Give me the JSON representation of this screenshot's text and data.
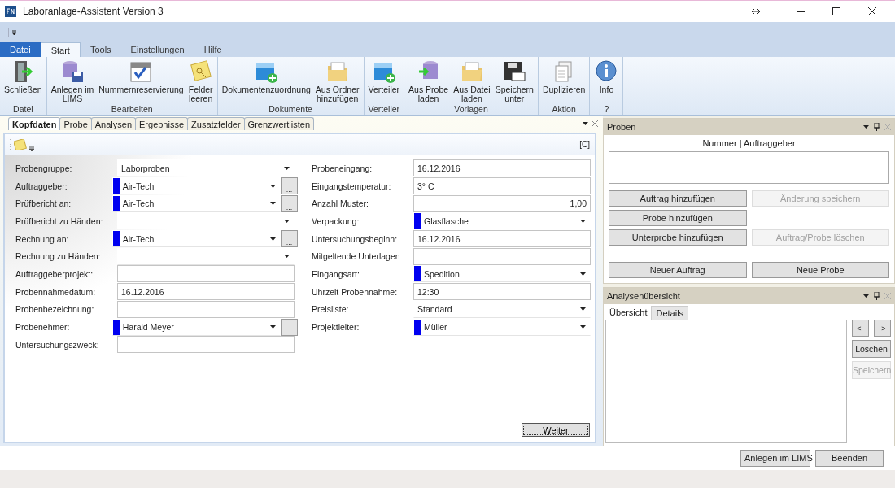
{
  "window": {
    "title": "Laboranlage-Assistent Version 3"
  },
  "ribbon_tabs": [
    {
      "label": "Datei",
      "kind": "file",
      "selected": false
    },
    {
      "label": "Start",
      "kind": "tab",
      "selected": true
    },
    {
      "label": "Tools",
      "kind": "tab",
      "selected": false
    },
    {
      "label": "Einstellungen",
      "kind": "tab",
      "selected": false
    },
    {
      "label": "Hilfe",
      "kind": "tab",
      "selected": false
    }
  ],
  "ribbon_groups": [
    {
      "label": "Datei",
      "items": [
        {
          "label": "Schließen",
          "kind": "exit"
        }
      ]
    },
    {
      "label": "Bearbeiten",
      "items": [
        {
          "label": "Anlegen im\nLIMS",
          "kind": "database-save"
        },
        {
          "label": "Nummernreservierung",
          "kind": "calendar"
        },
        {
          "label": "Felder\nleeren",
          "kind": "note"
        }
      ]
    },
    {
      "label": "Dokumente",
      "items": [
        {
          "label": "Dokumentenzuordnung",
          "kind": "box-plus"
        },
        {
          "label": "Aus Ordner\nhinzufügen",
          "kind": "folder"
        }
      ]
    },
    {
      "label": "Verteiler",
      "items": [
        {
          "label": "Verteiler",
          "kind": "box-plus"
        }
      ]
    },
    {
      "label": "Vorlagen",
      "items": [
        {
          "label": "Aus Probe\nladen",
          "kind": "database-load"
        },
        {
          "label": "Aus Datei\nladen",
          "kind": "folder"
        },
        {
          "label": "Speichern\nunter",
          "kind": "save-as"
        }
      ]
    },
    {
      "label": "Aktion",
      "items": [
        {
          "label": "Duplizieren",
          "kind": "copy"
        }
      ]
    },
    {
      "label": "?",
      "items": [
        {
          "label": "Info",
          "kind": "info"
        }
      ]
    }
  ],
  "document_tabs": [
    {
      "label": "Kopfdaten",
      "selected": true
    },
    {
      "label": "Probe",
      "selected": false
    },
    {
      "label": "Analysen",
      "selected": false
    },
    {
      "label": "Ergebnisse",
      "selected": false
    },
    {
      "label": "Zusatzfelder",
      "selected": false
    },
    {
      "label": "Grenzwertlisten",
      "selected": false
    }
  ],
  "document_toolbar": {
    "code": "[C]"
  },
  "form_left": [
    {
      "label": "Probengruppe:",
      "kind": "combo",
      "value": "Laborproben",
      "required": false
    },
    {
      "label": "Auftraggeber:",
      "kind": "combo",
      "value": "Air-Tech",
      "required": true,
      "browse_button": "..."
    },
    {
      "label": "Prüfbericht an:",
      "kind": "combo",
      "value": "Air-Tech",
      "required": true,
      "browse_button": "..."
    },
    {
      "label": "Prüfbericht zu Händen:",
      "kind": "combo",
      "required": false
    },
    {
      "label": "Rechnung an:",
      "kind": "combo",
      "value": "Air-Tech",
      "required": true,
      "browse_button": "..."
    },
    {
      "label": "Rechnung zu Händen:",
      "kind": "combo",
      "required": false
    },
    {
      "label": "Auftraggeberprojekt:",
      "kind": "text",
      "required": false
    },
    {
      "label": "Probennahmedatum:",
      "kind": "text",
      "value": "16.12.2016",
      "required": false
    },
    {
      "label": "Probenbezeichnung:",
      "kind": "text",
      "required": false
    },
    {
      "label": "Probenehmer:",
      "kind": "combo",
      "value": "Harald Meyer",
      "required": true,
      "browse_button": "..."
    },
    {
      "label": "Untersuchungszweck:",
      "kind": "text",
      "required": false
    }
  ],
  "form_right": [
    {
      "label": "Probeneingang:",
      "kind": "text",
      "value": "16.12.2016",
      "required": false
    },
    {
      "label": "Eingangstemperatur:",
      "kind": "text",
      "value": "3° C",
      "required": false
    },
    {
      "label": "Anzahl Muster:",
      "kind": "number",
      "value": "1,00",
      "required": false
    },
    {
      "label": "Verpackung:",
      "kind": "combo",
      "value": "Glasflasche",
      "required": true
    },
    {
      "label": "Untersuchungsbeginn:",
      "kind": "text",
      "value": "16.12.2016",
      "required": false
    },
    {
      "label": "Mitgeltende Unterlagen",
      "kind": "text",
      "required": false
    },
    {
      "label": "Eingangsart:",
      "kind": "combo",
      "value": "Spedition",
      "required": true
    },
    {
      "label": "Uhrzeit Probennahme:",
      "kind": "text",
      "value": "12:30",
      "required": false
    },
    {
      "label": "Preisliste:",
      "kind": "combo",
      "value": "Standard",
      "required": false
    },
    {
      "label": "Projektleiter:",
      "kind": "combo",
      "value": "Müller",
      "required": true
    }
  ],
  "next_button": {
    "label": "Weiter"
  },
  "proben_panel": {
    "title": "Proben",
    "list_header": "Nummer | Auftraggeber",
    "button_rows": [
      [
        {
          "label": "Auftrag hinzufügen",
          "disabled": false
        },
        {
          "label": "Änderung speichern",
          "disabled": true
        }
      ],
      [
        {
          "label": "Probe hinzufügen",
          "disabled": false
        }
      ],
      [
        {
          "label": "Unterprobe hinzufügen",
          "disabled": false
        },
        {
          "label": "Auftrag/Probe löschen",
          "disabled": true
        }
      ]
    ],
    "bottom_buttons": [
      {
        "label": "Neuer Auftrag",
        "disabled": false
      },
      {
        "label": "Neue Probe",
        "disabled": false
      }
    ]
  },
  "analysis_panel": {
    "title": "Analysenübersicht",
    "tabs": [
      {
        "label": "Übersicht",
        "selected": true
      },
      {
        "label": "Details",
        "selected": false
      }
    ],
    "arrow_buttons": [
      {
        "label": "<-",
        "disabled": false
      },
      {
        "label": "->",
        "disabled": false
      }
    ],
    "buttons": [
      {
        "label": "Löschen",
        "disabled": false
      },
      {
        "label": "Speichern",
        "disabled": true
      }
    ]
  },
  "footer_buttons": [
    {
      "label": "Anlegen im LIMS"
    },
    {
      "label": "Beenden"
    }
  ]
}
